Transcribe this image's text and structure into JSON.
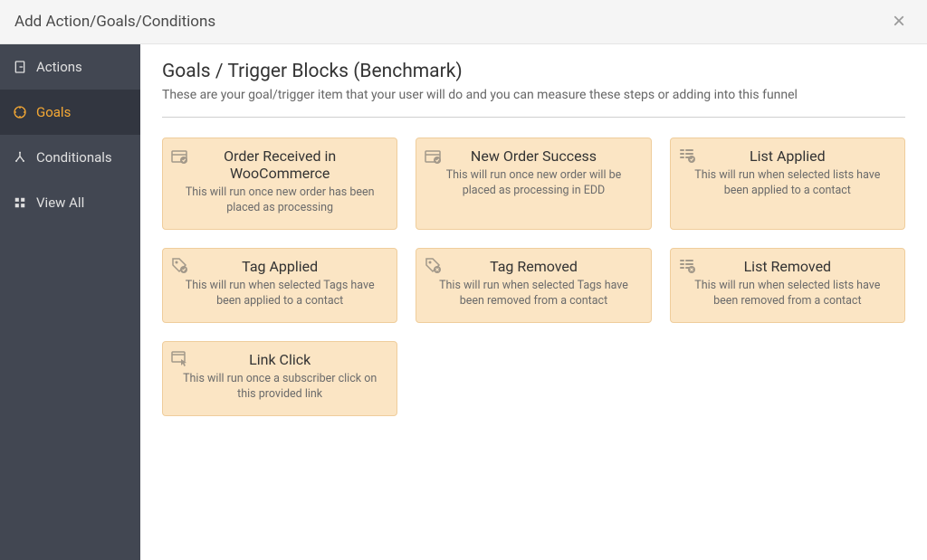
{
  "modal": {
    "title": "Add Action/Goals/Conditions"
  },
  "sidebar": {
    "items": [
      {
        "label": "Actions"
      },
      {
        "label": "Goals"
      },
      {
        "label": "Conditionals"
      },
      {
        "label": "View All"
      }
    ]
  },
  "content": {
    "title": "Goals / Trigger Blocks (Benchmark)",
    "subtitle": "These are your goal/trigger item that your user will do and you can measure these steps or adding into this funnel"
  },
  "cards": [
    {
      "title": "Order Received in WooCommerce",
      "desc": "This will run once new order has been placed as processing",
      "icon": "order"
    },
    {
      "title": "New Order Success",
      "desc": "This will run once new order will be placed as processing in EDD",
      "icon": "order"
    },
    {
      "title": "List Applied",
      "desc": "This will run when selected lists have been applied to a contact",
      "icon": "list-check"
    },
    {
      "title": "Tag Applied",
      "desc": "This will run when selected Tags have been applied to a contact",
      "icon": "tag-check"
    },
    {
      "title": "Tag Removed",
      "desc": "This will run when selected Tags have been removed from a contact",
      "icon": "tag-remove"
    },
    {
      "title": "List Removed",
      "desc": "This will run when selected lists have been removed from a contact",
      "icon": "list-remove"
    },
    {
      "title": "Link Click",
      "desc": "This will run once a subscriber click on this provided link",
      "icon": "link-click"
    }
  ]
}
